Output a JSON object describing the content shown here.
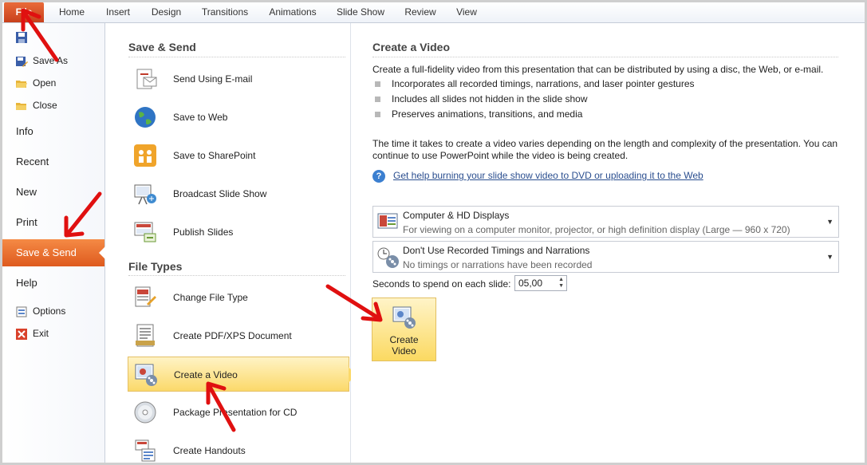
{
  "ribbon": {
    "tabs": [
      "File",
      "Home",
      "Insert",
      "Design",
      "Transitions",
      "Animations",
      "Slide Show",
      "Review",
      "View"
    ]
  },
  "nav": {
    "save": "Save",
    "save_as": "Save As",
    "open": "Open",
    "close": "Close",
    "info": "Info",
    "recent": "Recent",
    "new": "New",
    "print": "Print",
    "save_send": "Save & Send",
    "help": "Help",
    "options": "Options",
    "exit": "Exit"
  },
  "save_send": {
    "heading": "Save & Send",
    "items": [
      "Send Using E-mail",
      "Save to Web",
      "Save to SharePoint",
      "Broadcast Slide Show",
      "Publish Slides"
    ],
    "file_types_heading": "File Types",
    "file_types": [
      "Change File Type",
      "Create PDF/XPS Document",
      "Create a Video",
      "Package Presentation for CD",
      "Create Handouts"
    ]
  },
  "create_video": {
    "title": "Create a Video",
    "description": "Create a full-fidelity video from this presentation that can be distributed by using a disc, the Web, or e-mail.",
    "bullets": [
      "Incorporates all recorded timings, narrations, and laser pointer gestures",
      "Includes all slides not hidden in the slide show",
      "Preserves animations, transitions, and media"
    ],
    "time_note_1": "The time it takes to create a video varies depending on the length and complexity of the presentation. You can",
    "time_note_2": "continue to use PowerPoint while the video is being created.",
    "help_link": "Get help burning your slide show video to DVD or uploading it to the Web",
    "quality_title": "Computer & HD Displays",
    "quality_desc": "For viewing on a computer monitor, projector, or high definition display  (Large — 960 x 720)",
    "timing_title": "Don't Use Recorded Timings and Narrations",
    "timing_desc": "No timings or narrations have been recorded",
    "seconds_label": "Seconds to spend on each slide:",
    "seconds_value": "05,00",
    "button_label_1": "Create",
    "button_label_2": "Video"
  },
  "colors": {
    "file_tab": "#d4511e",
    "active_nav": "#e8692a",
    "highlight": "#fbd96a",
    "annotation_arrow": "#e01010"
  }
}
